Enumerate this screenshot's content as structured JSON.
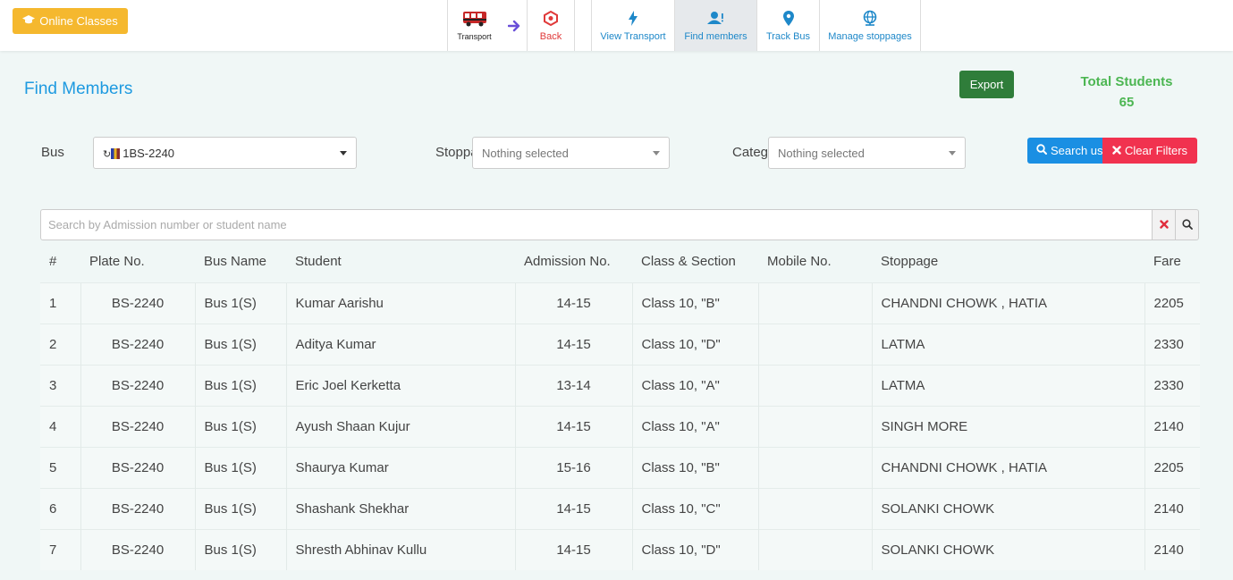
{
  "topbar": {
    "online_classes_label": "Online Classes",
    "nav": [
      {
        "label": "Transport",
        "icon": "bus-icon"
      },
      {
        "label": "",
        "icon": "arrow-right-icon"
      },
      {
        "label": "Back",
        "icon": "back-hexagon-icon"
      },
      {
        "label": "View Transport",
        "icon": "bolt-icon"
      },
      {
        "label": "Find members",
        "icon": "users-icon",
        "active": true
      },
      {
        "label": "Track Bus",
        "icon": "map-marker-icon"
      },
      {
        "label": "Manage stoppages",
        "icon": "globe-icon"
      }
    ]
  },
  "header": {
    "title": "Find Members",
    "export_label": "Export",
    "total_label": "Total Students",
    "total_value": "65"
  },
  "filters": {
    "bus_label": "Bus",
    "bus_value": "1BS-2240",
    "stoppage_label": "Stoppage",
    "stoppage_value": "Nothing selected",
    "category_label": "Category",
    "category_value": "Nothing selected",
    "search_button": "Search us",
    "clear_button": "Clear Filters"
  },
  "search": {
    "placeholder": "Search by Admission number or student name",
    "value": ""
  },
  "table": {
    "columns": [
      "#",
      "Plate No.",
      "Bus Name",
      "Student",
      "Admission No.",
      "Class & Section",
      "Mobile No.",
      "Stoppage",
      "Fare"
    ],
    "rows": [
      {
        "num": "1",
        "plate": "BS-2240",
        "bus": "Bus 1(S)",
        "student": "Kumar Aarishu",
        "admission": "14-15",
        "class": "Class 10, \"B\"",
        "mobile": "",
        "stoppage": "CHANDNI CHOWK , HATIA",
        "fare": "2205"
      },
      {
        "num": "2",
        "plate": "BS-2240",
        "bus": "Bus 1(S)",
        "student": "Aditya Kumar",
        "admission": "14-15",
        "class": "Class 10, \"D\"",
        "mobile": "",
        "stoppage": "LATMA",
        "fare": "2330"
      },
      {
        "num": "3",
        "plate": "BS-2240",
        "bus": "Bus 1(S)",
        "student": "Eric Joel Kerketta",
        "admission": "13-14",
        "class": "Class 10, \"A\"",
        "mobile": "",
        "stoppage": "LATMA",
        "fare": "2330"
      },
      {
        "num": "4",
        "plate": "BS-2240",
        "bus": "Bus 1(S)",
        "student": "Ayush Shaan Kujur",
        "admission": "14-15",
        "class": "Class 10, \"A\"",
        "mobile": "",
        "stoppage": "SINGH MORE",
        "fare": "2140"
      },
      {
        "num": "5",
        "plate": "BS-2240",
        "bus": "Bus 1(S)",
        "student": "Shaurya Kumar",
        "admission": "15-16",
        "class": "Class 10, \"B\"",
        "mobile": "",
        "stoppage": "CHANDNI CHOWK , HATIA",
        "fare": "2205"
      },
      {
        "num": "6",
        "plate": "BS-2240",
        "bus": "Bus 1(S)",
        "student": "Shashank Shekhar",
        "admission": "14-15",
        "class": "Class 10, \"C\"",
        "mobile": "",
        "stoppage": "SOLANKI CHOWK",
        "fare": "2140"
      },
      {
        "num": "7",
        "plate": "BS-2240",
        "bus": "Bus 1(S)",
        "student": "Shresth Abhinav Kullu",
        "admission": "14-15",
        "class": "Class 10, \"D\"",
        "mobile": "",
        "stoppage": "SOLANKI CHOWK",
        "fare": "2140"
      }
    ]
  },
  "colors": {
    "online_btn": "#f5b82e",
    "title_blue": "#1e9ae0",
    "export_green": "#2f7d3a",
    "total_green": "#4cb652",
    "search_blue": "#1a8fe3",
    "clear_red": "#f1324f"
  }
}
